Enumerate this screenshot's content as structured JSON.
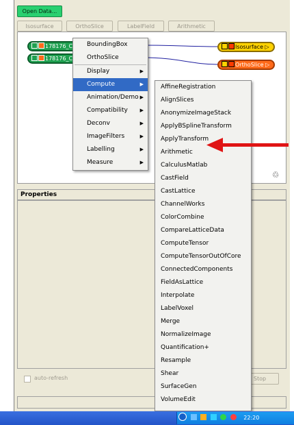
{
  "toolbar": {
    "open_data": "Open Data...",
    "isosurface": "Isosurface",
    "orthoslice": "OrthoSlice",
    "labelfield": "LabelField",
    "arithmetic": "Arithmetic"
  },
  "pool": {
    "node1": "178176_C",
    "node2": "178176_C",
    "node_iso": "Isosurface",
    "node_ortho": "OrthoSlice"
  },
  "context_menu": {
    "items": [
      {
        "label": "BoundingBox"
      },
      {
        "label": "OrthoSlice"
      },
      {
        "label": "Display"
      },
      {
        "label": "Compute"
      },
      {
        "label": "Animation/Demo"
      },
      {
        "label": "Compatibility"
      },
      {
        "label": "Deconv"
      },
      {
        "label": "ImageFilters"
      },
      {
        "label": "Labelling"
      },
      {
        "label": "Measure"
      }
    ]
  },
  "compute_submenu": {
    "items": [
      "AffineRegistration",
      "AlignSlices",
      "AnonymizeImageStack",
      "ApplyBSplineTransform",
      "ApplyTransform",
      "Arithmetic",
      "CalculusMatlab",
      "CastField",
      "CastLattice",
      "ChannelWorks",
      "ColorCombine",
      "CompareLatticeData",
      "ComputeTensor",
      "ComputeTensorOutOfCore",
      "ConnectedComponents",
      "FieldAsLattice",
      "Interpolate",
      "LabelVoxel",
      "Merge",
      "NormalizeImage",
      "Quantification+",
      "Resample",
      "Shear",
      "SurfaceGen",
      "VolumeEdit"
    ]
  },
  "properties": {
    "header": "Properties",
    "auto_refresh": "auto-refresh",
    "stop": "Stop"
  },
  "taskbar": {
    "time": "22:20"
  },
  "colors": {
    "arrow": "#e01414",
    "menu_highlight": "#316ac5"
  }
}
